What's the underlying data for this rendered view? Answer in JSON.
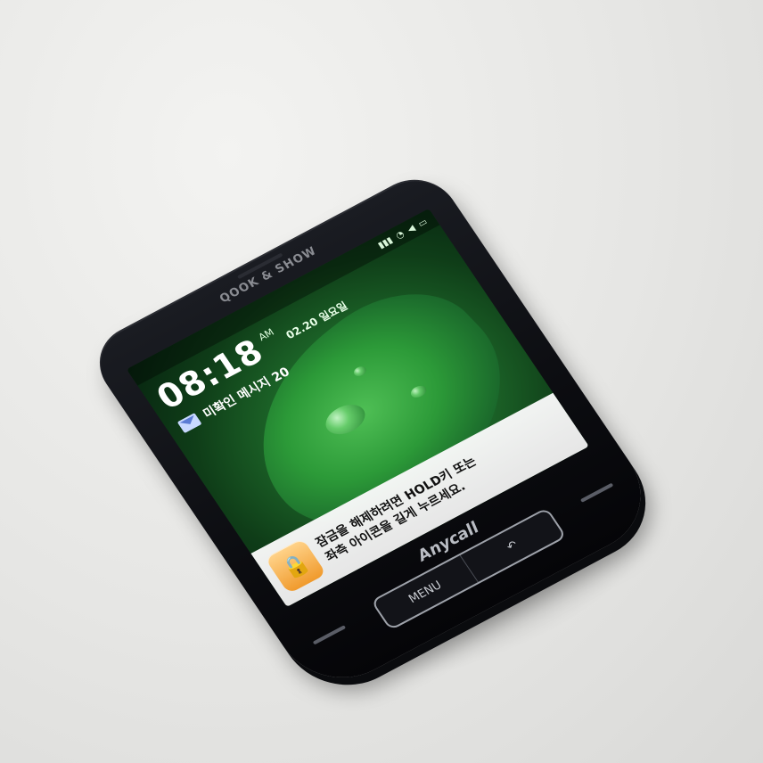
{
  "phone": {
    "carrier_logo": "QOOK & SHOW",
    "brand": "Anycall",
    "status_icons": [
      "wifi-icon",
      "signal-icon",
      "volume-icon",
      "battery-icon"
    ],
    "lockscreen": {
      "time": "08:18",
      "ampm": "AM",
      "date": "02.20 일요일",
      "unread_messages": "미확인 메시지 20",
      "unlock_hint_line1": "잠금을 해제하려면 HOLD키 또는",
      "unlock_hint_line2": "좌측 아이콘을 길게 누르세요."
    },
    "buttons": {
      "menu": "MENU",
      "back_icon": "back-arrow-icon"
    },
    "colors": {
      "body": "#0c0d11",
      "screen_green": "#2c9a38",
      "lock_icon": "#f09a2c"
    }
  }
}
